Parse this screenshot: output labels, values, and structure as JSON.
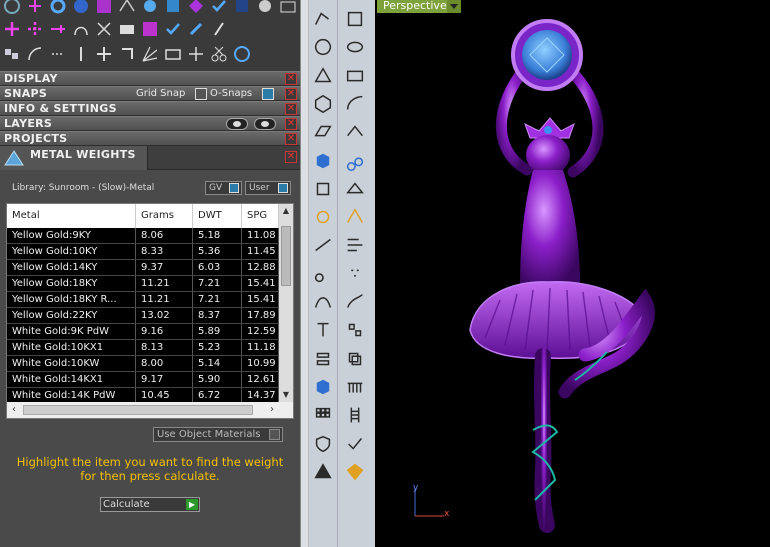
{
  "sections": {
    "display": "DISPLAY",
    "snaps": "SNAPS",
    "grid_snap": "Grid Snap",
    "o_snaps": "O-Snaps",
    "info_settings": "INFO & SETTINGS",
    "layers": "LAYERS",
    "projects": "PROJECTS",
    "close_glyph": "✕"
  },
  "metal_weights": {
    "title": "METAL WEIGHTS",
    "library": "Library: Sunroom - (Slow)-Metal",
    "gv_label": "GV",
    "user_label": "User",
    "columns": [
      "Metal",
      "Grams",
      "DWT",
      "SPG"
    ],
    "rows": [
      [
        "Yellow Gold:9KY",
        "8.06",
        "5.18",
        "11.08"
      ],
      [
        "Yellow Gold:10KY",
        "8.33",
        "5.36",
        "11.45"
      ],
      [
        "Yellow Gold:14KY",
        "9.37",
        "6.03",
        "12.88"
      ],
      [
        "Yellow Gold:18KY",
        "11.21",
        "7.21",
        "15.41"
      ],
      [
        "Yellow Gold:18KY R...",
        "11.21",
        "7.21",
        "15.41"
      ],
      [
        "Yellow Gold:22KY",
        "13.02",
        "8.37",
        "17.89"
      ],
      [
        "White Gold:9K PdW",
        "9.16",
        "5.89",
        "12.59"
      ],
      [
        "White Gold:10KX1",
        "8.13",
        "5.23",
        "11.18"
      ],
      [
        "White Gold:10KW",
        "8.00",
        "5.14",
        "10.99"
      ],
      [
        "White Gold:14KX1",
        "9.17",
        "5.90",
        "12.61"
      ],
      [
        "White Gold:14K PdW",
        "10.45",
        "6.72",
        "14.37"
      ]
    ],
    "use_object_materials": "Use Object Materials",
    "hint_line1": "Highlight the item you want to find the weight",
    "hint_line2": "for then press calculate.",
    "calculate": "Calculate"
  },
  "viewport": {
    "label": "Perspective",
    "axis_y": "y",
    "axis_x": "x"
  },
  "colors": {
    "accent_yellow": "#f5c000",
    "viewport_label": "#7da13b",
    "model_purple": "#8b1fc9"
  }
}
